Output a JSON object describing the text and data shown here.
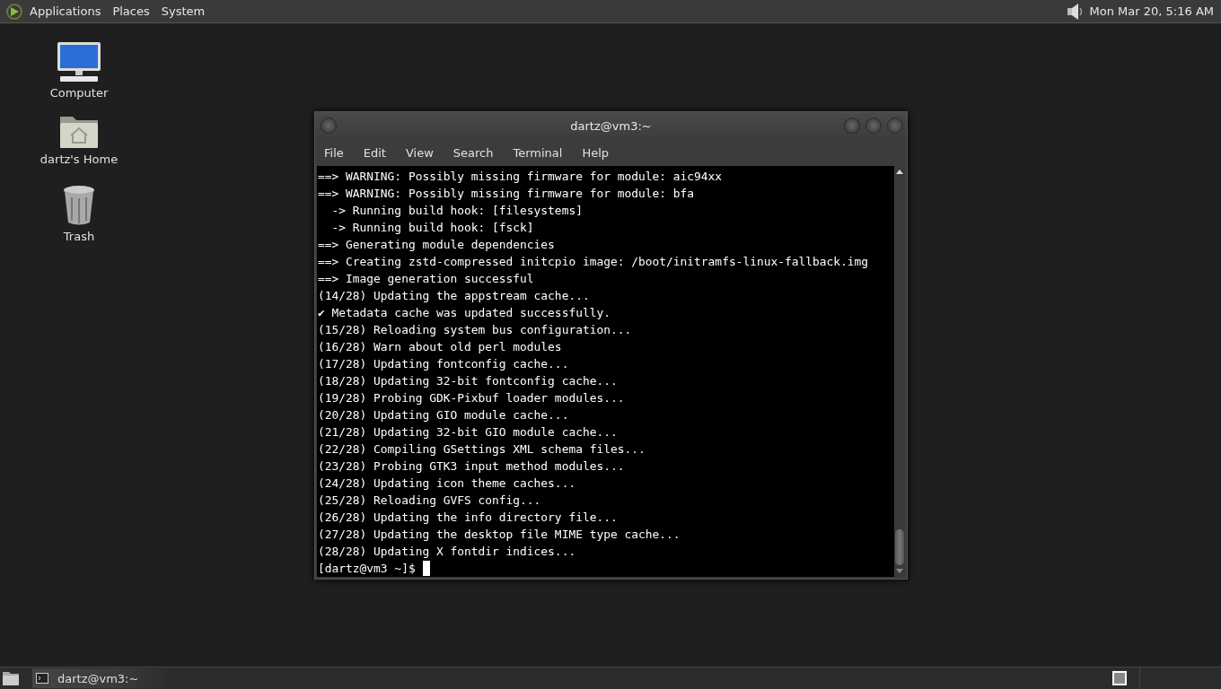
{
  "top_panel": {
    "menus": [
      "Applications",
      "Places",
      "System"
    ],
    "clock": "Mon Mar 20,  5:16 AM"
  },
  "desktop_icons": [
    {
      "kind": "computer",
      "label": "Computer"
    },
    {
      "kind": "home",
      "label": "dartz's Home"
    },
    {
      "kind": "trash",
      "label": "Trash"
    }
  ],
  "terminal": {
    "title": "dartz@vm3:~",
    "menu": [
      "File",
      "Edit",
      "View",
      "Search",
      "Terminal",
      "Help"
    ],
    "lines": [
      "==> WARNING: Possibly missing firmware for module: aic94xx",
      "==> WARNING: Possibly missing firmware for module: bfa",
      "  -> Running build hook: [filesystems]",
      "  -> Running build hook: [fsck]",
      "==> Generating module dependencies",
      "==> Creating zstd-compressed initcpio image: /boot/initramfs-linux-fallback.img",
      "==> Image generation successful",
      "(14/28) Updating the appstream cache...",
      "✔ Metadata cache was updated successfully.",
      "(15/28) Reloading system bus configuration...",
      "(16/28) Warn about old perl modules",
      "(17/28) Updating fontconfig cache...",
      "(18/28) Updating 32-bit fontconfig cache...",
      "(19/28) Probing GDK-Pixbuf loader modules...",
      "(20/28) Updating GIO module cache...",
      "(21/28) Updating 32-bit GIO module cache...",
      "(22/28) Compiling GSettings XML schema files...",
      "(23/28) Probing GTK3 input method modules...",
      "(24/28) Updating icon theme caches...",
      "(25/28) Reloading GVFS config...",
      "(26/28) Updating the info directory file...",
      "(27/28) Updating the desktop file MIME type cache...",
      "(28/28) Updating X fontdir indices..."
    ],
    "prompt": "[dartz@vm3 ~]$"
  },
  "taskbar": {
    "tasks": [
      {
        "label": "dartz@vm3:~",
        "selected": true
      }
    ]
  }
}
